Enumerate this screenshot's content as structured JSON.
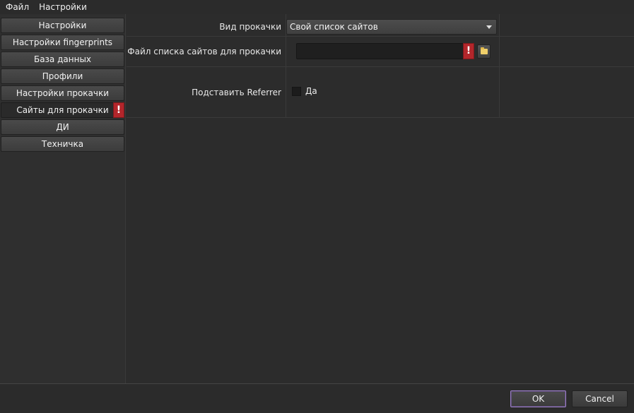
{
  "menu": [
    "Файл",
    "Настройки"
  ],
  "sidebar": {
    "items": [
      {
        "label": "Настройки"
      },
      {
        "label": "Настройки fingerprints"
      },
      {
        "label": "База данных"
      },
      {
        "label": "Профили"
      },
      {
        "label": "Настройки прокачки"
      },
      {
        "label": "Сайты для прокачки",
        "warning": "!"
      },
      {
        "label": "ДИ"
      },
      {
        "label": "Техничка"
      }
    ]
  },
  "form": {
    "mode_label": "Вид прокачки",
    "mode_value": "Свой список сайтов",
    "file_label": "Файл списка сайтов для прокачки",
    "file_value": "",
    "file_warning": "!",
    "referrer_label": "Подставить Referrer",
    "referrer_checkbox_label": "Да",
    "referrer_checked": false
  },
  "footer": {
    "ok_label": "OK",
    "cancel_label": "Cancel"
  },
  "colors": {
    "warning": "#b3262b",
    "ok_focus": "#9a7fc4",
    "folder": "#f0cf6a"
  }
}
